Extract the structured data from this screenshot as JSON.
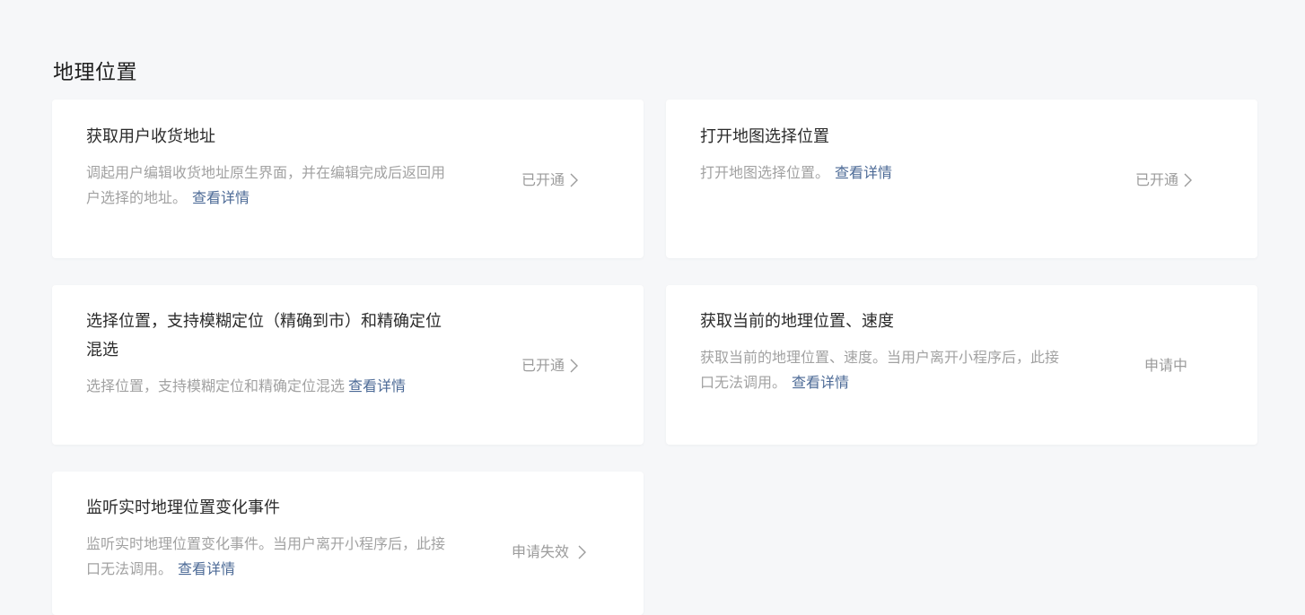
{
  "section": {
    "title": "地理位置"
  },
  "cards": [
    {
      "title": "获取用户收货地址",
      "desc": "调起用户编辑收货地址原生界面，并在编辑完成后返回用户选择的地址。",
      "link": "查看详情",
      "status": "已开通",
      "has_chevron": true
    },
    {
      "title": "打开地图选择位置",
      "desc": "打开地图选择位置。",
      "link": "查看详情",
      "status": "已开通",
      "has_chevron": true
    },
    {
      "title": "选择位置，支持模糊定位（精确到市）和精确定位混选",
      "desc": "选择位置，支持模糊定位和精确定位混选",
      "link": "查看详情",
      "status": "已开通",
      "has_chevron": true
    },
    {
      "title": "获取当前的地理位置、速度",
      "desc": "获取当前的地理位置、速度。当用户离开小程序后，此接口无法调用。",
      "link": "查看详情",
      "status": "申请中",
      "has_chevron": false
    },
    {
      "title": "监听实时地理位置变化事件",
      "desc": "监听实时地理位置变化事件。当用户离开小程序后，此接口无法调用。",
      "link": "查看详情",
      "status": "申请失效",
      "has_chevron": true
    }
  ]
}
